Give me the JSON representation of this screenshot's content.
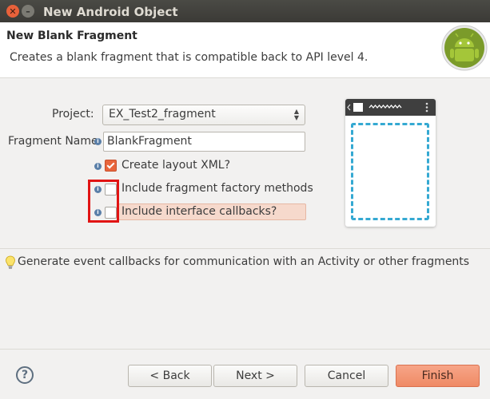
{
  "window": {
    "title": "New Android Object"
  },
  "header": {
    "title": "New Blank Fragment",
    "description": "Creates a blank fragment that is compatible back to API level 4."
  },
  "form": {
    "project_label": "Project:",
    "project_value": "EX_Test2_fragment",
    "fragment_name_label": "Fragment Name",
    "fragment_name_value": "BlankFragment",
    "options": [
      {
        "label": "Create layout XML?",
        "checked": true
      },
      {
        "label": "Include fragment factory methods",
        "checked": false
      },
      {
        "label": "Include interface callbacks?",
        "checked": false
      }
    ]
  },
  "hint": {
    "text": "Generate event callbacks for communication with an Activity or other fragments"
  },
  "footer": {
    "help_label": "?",
    "back_label": "< Back",
    "next_label": "Next >",
    "cancel_label": "Cancel",
    "finish_label": "Finish"
  },
  "colors": {
    "accent": "#ef8a65",
    "checkbox_checked": "#e8653c",
    "preview_dashed": "#35a9d2",
    "highlight_box": "#e11414",
    "android_green": "#a4c639"
  }
}
